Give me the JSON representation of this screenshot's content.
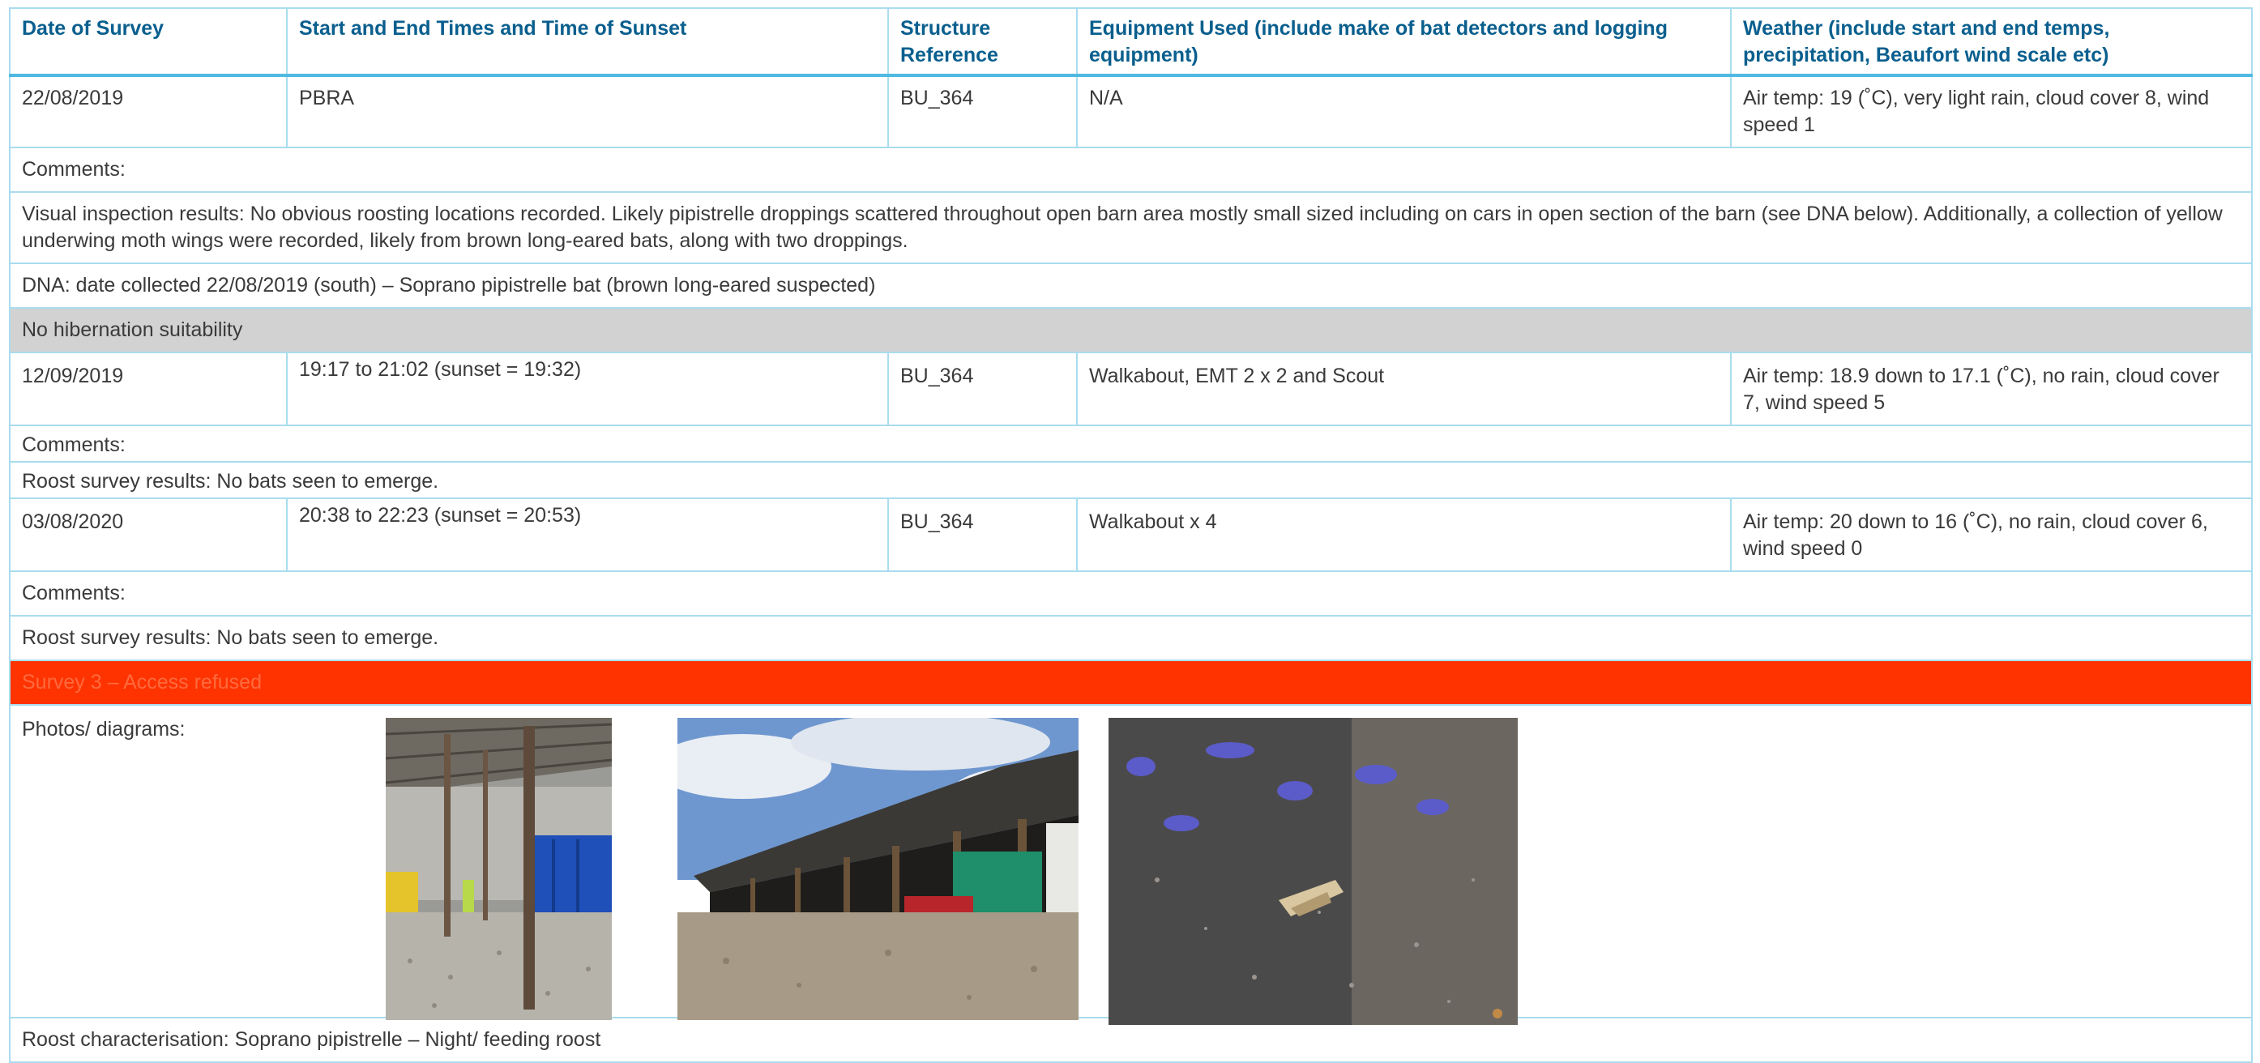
{
  "table": {
    "headers": [
      "Date of Survey",
      "Start and End Times and Time of Sunset",
      "Structure Reference",
      "Equipment Used (include make of bat detectors and logging equipment)",
      "Weather (include start and end temps, precipitation, Beaufort wind scale etc)"
    ],
    "survey1": {
      "date": "22/08/2019",
      "times": "PBRA",
      "structure": "BU_364",
      "equipment": "N/A",
      "weather": "Air temp: 19 (˚C), very light rain, cloud cover 8, wind speed 1",
      "comments_label": "Comments:",
      "visual_inspection": "Visual inspection results: No obvious roosting locations recorded. Likely pipistrelle droppings scattered throughout open barn area mostly small sized including on cars in open section of the barn (see DNA below). Additionally, a collection of yellow underwing moth wings were recorded, likely from brown long-eared bats, along with two droppings.",
      "dna": "DNA: date collected 22/08/2019 (south) – Soprano pipistrelle bat (brown long-eared suspected)"
    },
    "hibernation": "No hibernation suitability",
    "survey2": {
      "date": "12/09/2019",
      "times": "19:17 to 21:02 (sunset = 19:32)",
      "structure": "BU_364",
      "equipment": "Walkabout, EMT 2 x 2 and Scout",
      "weather": "Air temp: 18.9 down to 17.1 (˚C), no rain, cloud cover 7, wind speed 5",
      "comments_label": "Comments:",
      "result": "Roost survey results: No bats seen to emerge."
    },
    "survey3": {
      "date": "03/08/2020",
      "times": "20:38 to 22:23 (sunset = 20:53)",
      "structure": "BU_364",
      "equipment": "Walkabout x 4",
      "weather": "Air temp: 20 down to 16 (˚C), no rain, cloud cover 6, wind speed 0",
      "comments_label": "Comments:",
      "result": "Roost survey results: No bats seen to emerge."
    },
    "access_refused": "Survey 3 – Access refused",
    "photos_label": "Photos/ diagrams:",
    "characterisation": "Roost characterisation: Soprano pipistrelle – Night/ feeding roost"
  },
  "colors": {
    "header_text": "#0a5f8e",
    "border": "#a9dcee",
    "header_rule": "#4fb9e0",
    "grey_band": "#d2d2d2",
    "red_band": "#ff3300"
  }
}
